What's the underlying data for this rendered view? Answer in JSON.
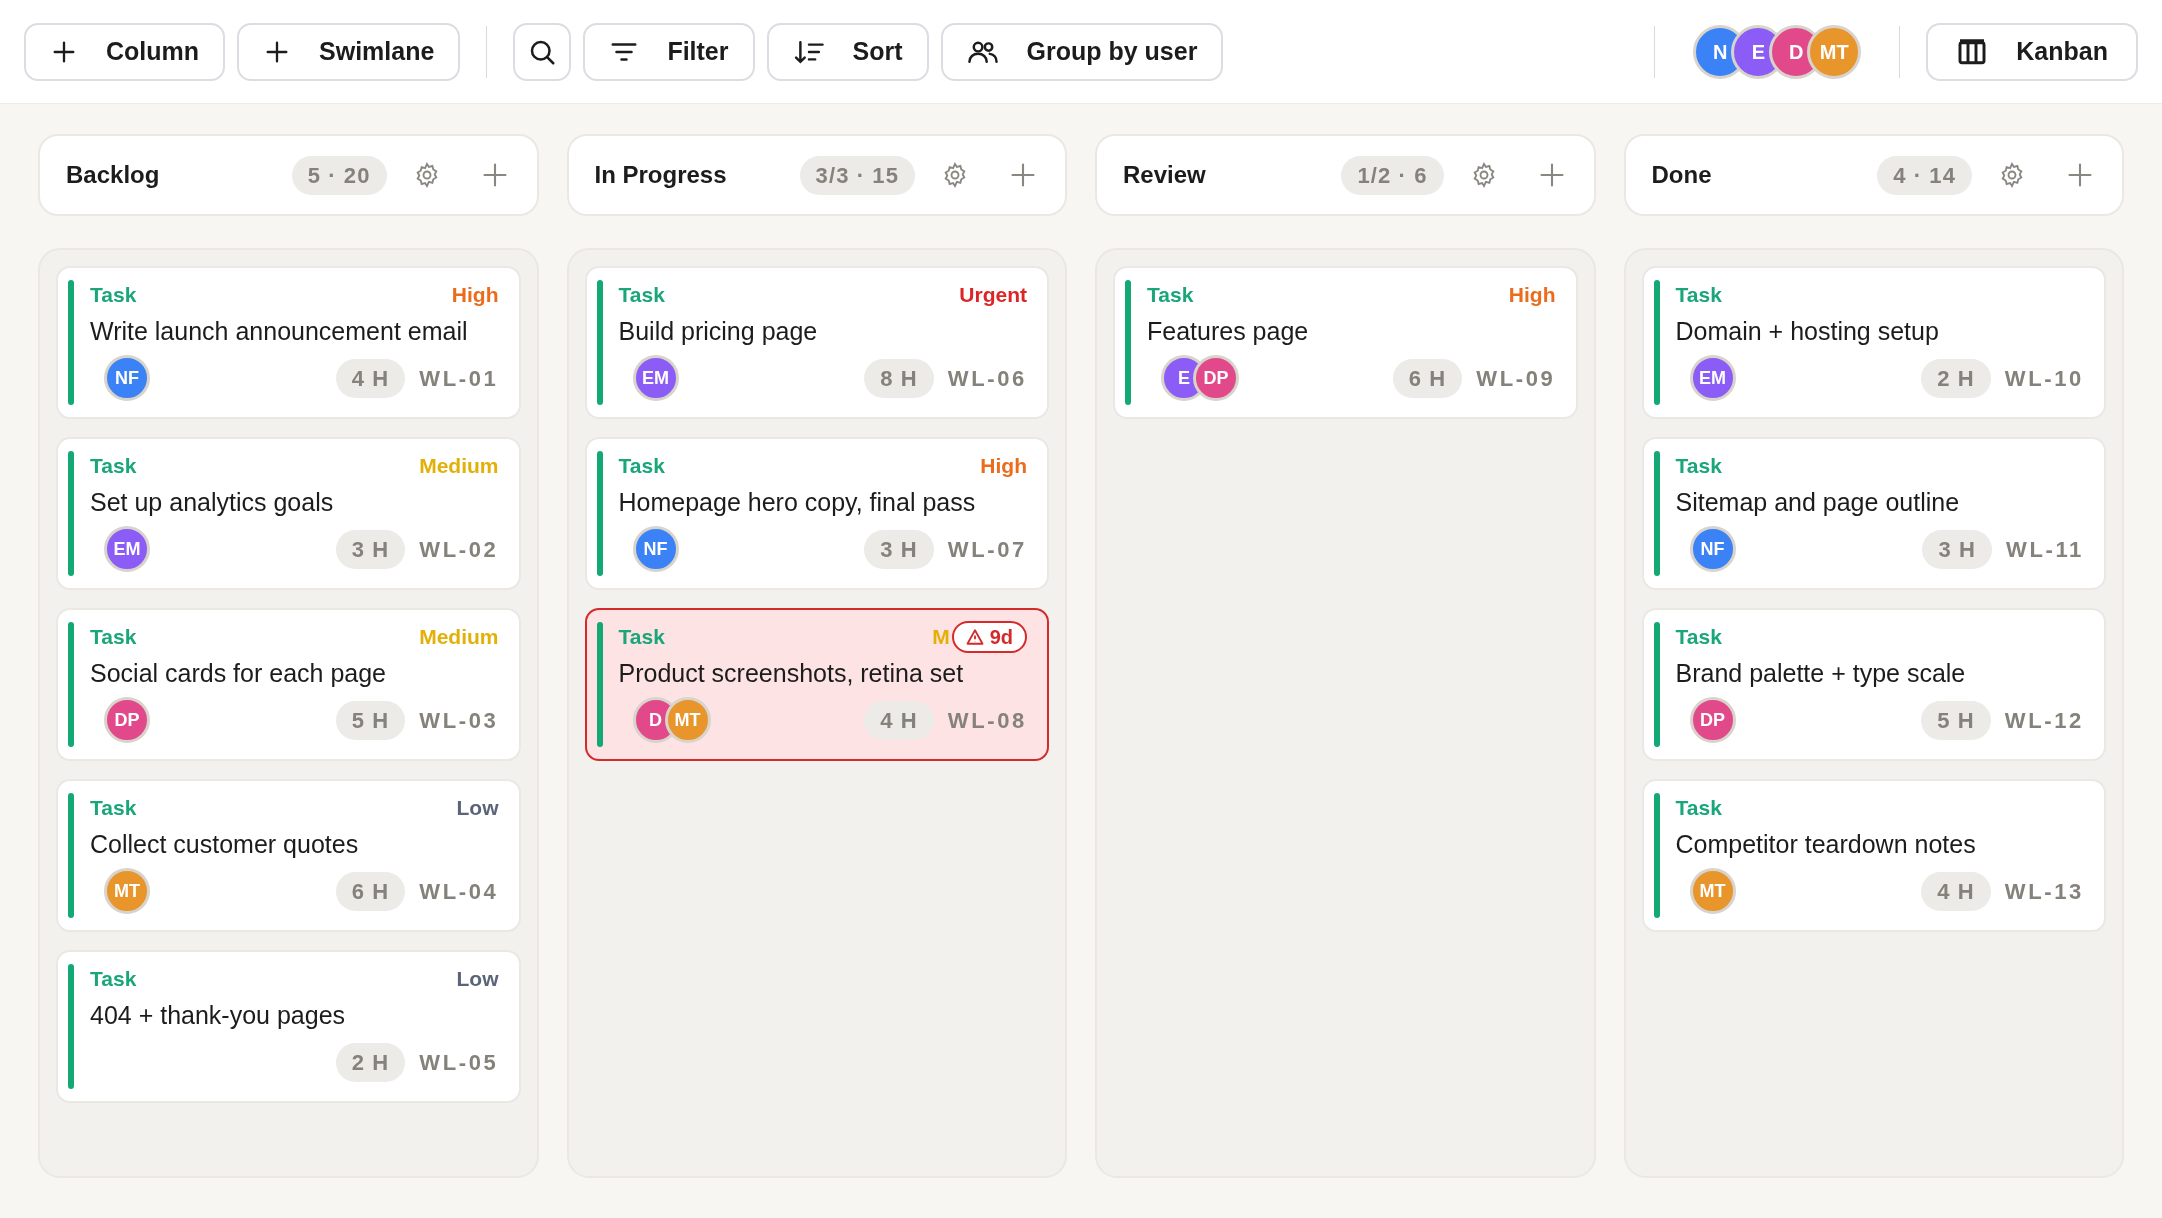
{
  "toolbar": {
    "left": [
      {
        "kind": "plus",
        "label": "Column"
      },
      {
        "kind": "plus",
        "label": "Swimlane"
      }
    ],
    "tools": [
      {
        "kind": "search"
      },
      {
        "kind": "filter",
        "label": "Filter"
      },
      {
        "kind": "sort",
        "label": "Sort"
      },
      {
        "kind": "group",
        "label": "Group by user"
      }
    ],
    "members": [
      {
        "initials": "N",
        "color": "#3b82f6"
      },
      {
        "initials": "E",
        "color": "#8b5cf6"
      },
      {
        "initials": "D",
        "color": "#e2498a"
      },
      {
        "initials": "MT",
        "color": "#e8952c"
      }
    ],
    "view": {
      "label": "Kanban"
    }
  },
  "columns": [
    {
      "title": "Backlog",
      "count": "5 · 20",
      "cards": [
        {
          "type": "Task",
          "priority": "High",
          "color": "#ea6c1c",
          "title": "Write launch announcement email",
          "assignees": [
            {
              "initials": "NF",
              "color": "#3b82f6"
            }
          ],
          "estimate": "4 H",
          "id": "WL-01",
          "overdue": false
        },
        {
          "type": "Task",
          "priority": "Medium",
          "color": "#e3b008",
          "title": "Set up analytics goals",
          "assignees": [
            {
              "initials": "EM",
              "color": "#8b5cf6"
            }
          ],
          "estimate": "3 H",
          "id": "WL-02",
          "overdue": false
        },
        {
          "type": "Task",
          "priority": "Medium",
          "color": "#e3b008",
          "title": "Social cards for each page",
          "assignees": [
            {
              "initials": "DP",
              "color": "#e2498a"
            }
          ],
          "estimate": "5 H",
          "id": "WL-03",
          "overdue": false
        },
        {
          "type": "Task",
          "priority": "Low",
          "color": "#5b6478",
          "title": "Collect customer quotes",
          "assignees": [
            {
              "initials": "MT",
              "color": "#e8952c"
            }
          ],
          "estimate": "6 H",
          "id": "WL-04",
          "overdue": false
        },
        {
          "type": "Task",
          "priority": "Low",
          "color": "#5b6478",
          "title": "404 + thank-you pages",
          "estimate": "2 H",
          "id": "WL-05",
          "overdue": false
        }
      ]
    },
    {
      "title": "In Progress",
      "count": "3/3 · 15",
      "cards": [
        {
          "type": "Task",
          "priority": "Urgent",
          "color": "#dc2626",
          "title": "Build pricing page",
          "assignees": [
            {
              "initials": "EM",
              "color": "#8b5cf6"
            }
          ],
          "estimate": "8 H",
          "id": "WL-06",
          "overdue": false
        },
        {
          "type": "Task",
          "priority": "High",
          "color": "#ea6c1c",
          "title": "Homepage hero copy, final pass",
          "assignees": [
            {
              "initials": "NF",
              "color": "#3b82f6"
            }
          ],
          "estimate": "3 H",
          "id": "WL-07",
          "overdue": false
        },
        {
          "type": "Task",
          "priority": "M",
          "color": "#e3b008",
          "title": "Product screenshots, retina set",
          "assignees": [
            {
              "initials": "D",
              "color": "#e2498a"
            },
            {
              "initials": "MT",
              "color": "#e8952c"
            }
          ],
          "estimate": "4 H",
          "id": "WL-08",
          "overdue": true,
          "overdue_label": "9d"
        }
      ]
    },
    {
      "title": "Review",
      "count": "1/2 · 6",
      "cards": [
        {
          "type": "Task",
          "priority": "High",
          "color": "#ea6c1c",
          "title": "Features page",
          "assignees": [
            {
              "initials": "E",
              "color": "#8b5cf6"
            },
            {
              "initials": "DP",
              "color": "#e2498a"
            }
          ],
          "estimate": "6 H",
          "id": "WL-09",
          "overdue": false
        }
      ]
    },
    {
      "title": "Done",
      "count": "4 · 14",
      "cards": [
        {
          "type": "Task",
          "title": "Domain + hosting setup",
          "assignees": [
            {
              "initials": "EM",
              "color": "#8b5cf6"
            }
          ],
          "estimate": "2 H",
          "id": "WL-10",
          "overdue": false
        },
        {
          "type": "Task",
          "title": "Sitemap and page outline",
          "assignees": [
            {
              "initials": "NF",
              "color": "#3b82f6"
            }
          ],
          "estimate": "3 H",
          "id": "WL-11",
          "overdue": false
        },
        {
          "type": "Task",
          "title": "Brand palette + type scale",
          "assignees": [
            {
              "initials": "DP",
              "color": "#e2498a"
            }
          ],
          "estimate": "5 H",
          "id": "WL-12",
          "overdue": false
        },
        {
          "type": "Task",
          "title": "Competitor teardown notes",
          "assignees": [
            {
              "initials": "MT",
              "color": "#e8952c"
            }
          ],
          "estimate": "4 H",
          "id": "WL-13",
          "overdue": false
        }
      ]
    }
  ]
}
